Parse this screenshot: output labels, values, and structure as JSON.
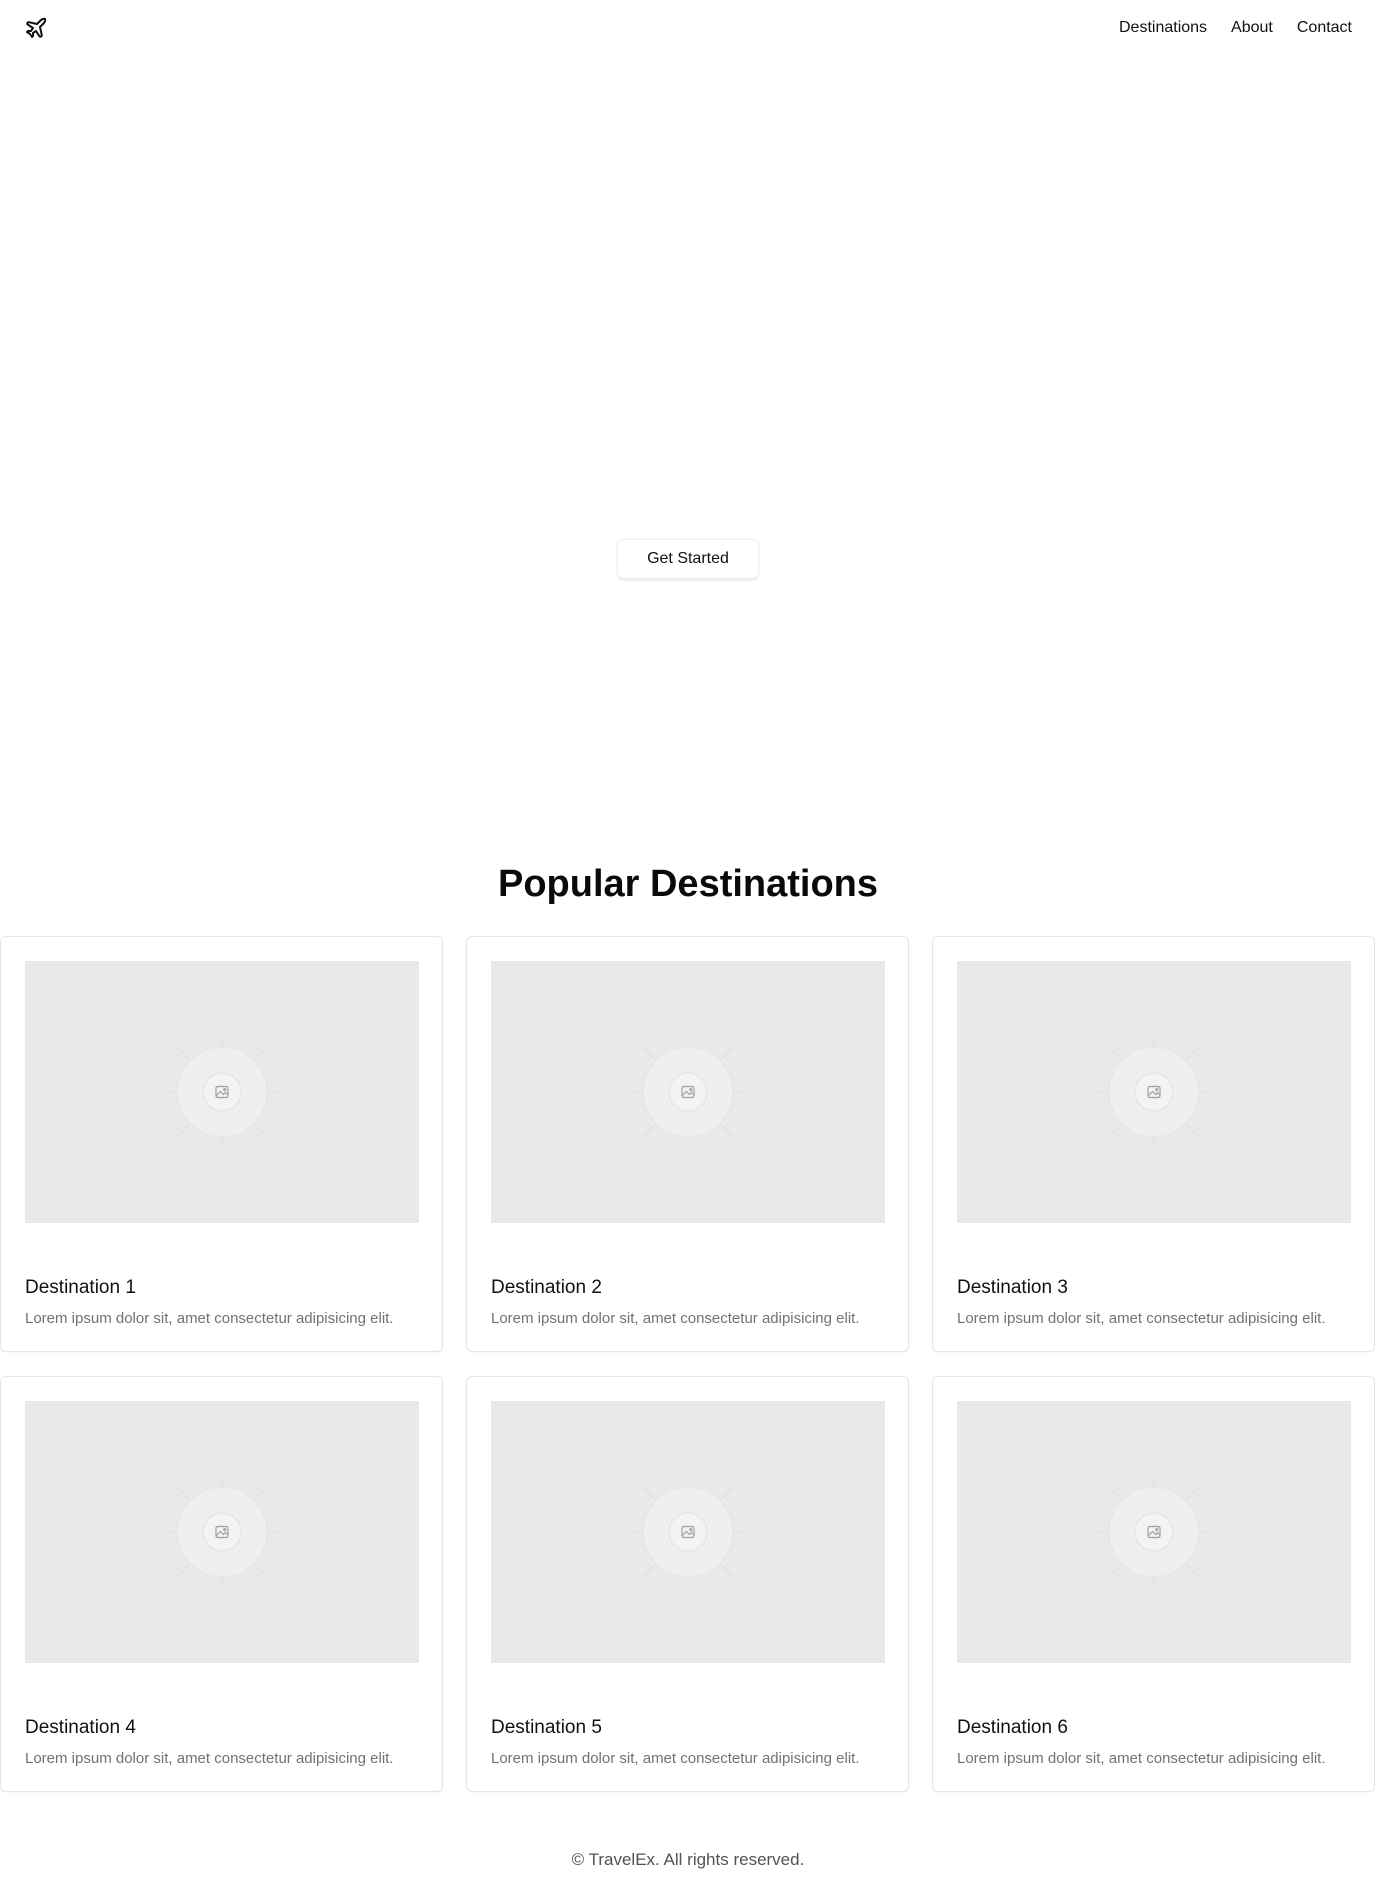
{
  "header": {
    "logo_icon": "plane-icon",
    "nav": [
      {
        "label": "Destinations"
      },
      {
        "label": "About"
      },
      {
        "label": "Contact"
      }
    ]
  },
  "hero": {
    "cta_label": "Get Started"
  },
  "destinations": {
    "title": "Popular Destinations",
    "image_icon": "image-placeholder-icon",
    "cards": [
      {
        "title": "Destination 1",
        "description": "Lorem ipsum dolor sit, amet consectetur adipisicing elit."
      },
      {
        "title": "Destination 2",
        "description": "Lorem ipsum dolor sit, amet consectetur adipisicing elit."
      },
      {
        "title": "Destination 3",
        "description": "Lorem ipsum dolor sit, amet consectetur adipisicing elit."
      },
      {
        "title": "Destination 4",
        "description": "Lorem ipsum dolor sit, amet consectetur adipisicing elit."
      },
      {
        "title": "Destination 5",
        "description": "Lorem ipsum dolor sit, amet consectetur adipisicing elit."
      },
      {
        "title": "Destination 6",
        "description": "Lorem ipsum dolor sit, amet consectetur adipisicing elit."
      }
    ]
  },
  "footer": {
    "text": "© TravelEx. All rights reserved."
  },
  "colors": {
    "text": "#111111",
    "muted": "#71717a",
    "placeholder_bg": "#e9e9e9",
    "border": "#e5e5e5"
  }
}
